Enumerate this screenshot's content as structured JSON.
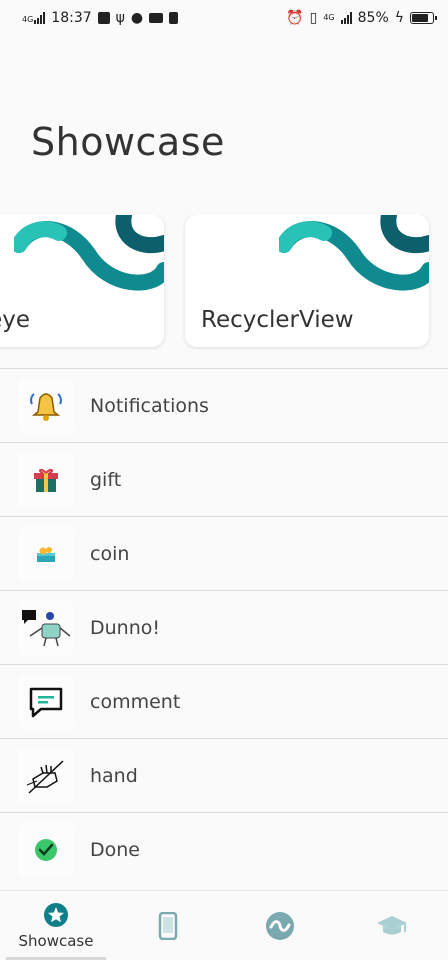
{
  "status_bar": {
    "network": "4G",
    "time": "18:37",
    "right_network": "4G",
    "battery": "85%"
  },
  "page": {
    "title": "Showcase"
  },
  "cards": [
    {
      "label": "eye"
    },
    {
      "label": "RecyclerView"
    }
  ],
  "list": [
    {
      "label": "Notifications",
      "icon": "bell-icon"
    },
    {
      "label": "gift",
      "icon": "gift-icon"
    },
    {
      "label": "coin",
      "icon": "coin-icon"
    },
    {
      "label": "Dunno!",
      "icon": "dunno-icon"
    },
    {
      "label": "comment",
      "icon": "comment-icon"
    },
    {
      "label": "hand",
      "icon": "hand-icon"
    },
    {
      "label": "Done",
      "icon": "done-icon"
    }
  ],
  "bottom_nav": [
    {
      "label": "Showcase",
      "icon": "star-icon",
      "active": true
    },
    {
      "label": "",
      "icon": "phone-icon"
    },
    {
      "label": "",
      "icon": "lottie-logo-icon"
    },
    {
      "label": "",
      "icon": "graduation-cap-icon"
    }
  ],
  "colors": {
    "accent": "#0f8a8f",
    "accent_light": "#28c3b6",
    "accent_dark": "#0c5f6b"
  }
}
